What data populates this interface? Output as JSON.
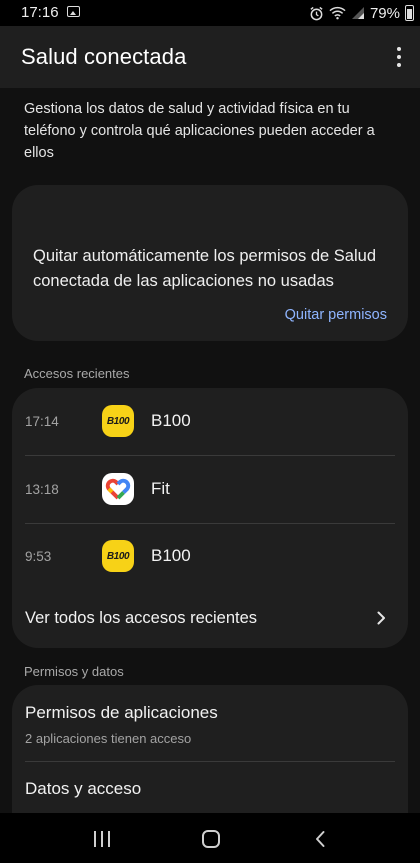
{
  "status_bar": {
    "time": "17:16",
    "battery": "79%",
    "icons": [
      "image-icon",
      "alarm-icon",
      "wifi-icon",
      "signal-icon",
      "battery-icon"
    ]
  },
  "app_bar": {
    "title": "Salud conectada",
    "menu_icon": "more-vert-icon"
  },
  "description": "Gestiona los datos de salud y actividad física en tu teléfono y controla qué aplicaciones pueden acceder a ellos",
  "permissions_card": {
    "text": "Quitar automáticamente los permisos de Salud conectada de las aplicaciones no usadas",
    "action": "Quitar permisos"
  },
  "recent_access": {
    "label": "Accesos recientes",
    "items": [
      {
        "time": "17:14",
        "app": "B100",
        "icon": "b100-icon",
        "icon_text": "B100"
      },
      {
        "time": "13:18",
        "app": "Fit",
        "icon": "google-fit-icon"
      },
      {
        "time": "9:53",
        "app": "B100",
        "icon": "b100-icon",
        "icon_text": "B100"
      }
    ],
    "view_all": "Ver todos los accesos recientes"
  },
  "permissions_data": {
    "label": "Permisos y datos",
    "items": [
      {
        "title": "Permisos de aplicaciones",
        "subtitle": "2 aplicaciones tienen acceso"
      },
      {
        "title": "Datos y acceso"
      }
    ]
  },
  "colors": {
    "background": "#111111",
    "card": "#1f1f1f",
    "accent_link": "#8fb5ff",
    "b100_yellow": "#f7d217"
  }
}
